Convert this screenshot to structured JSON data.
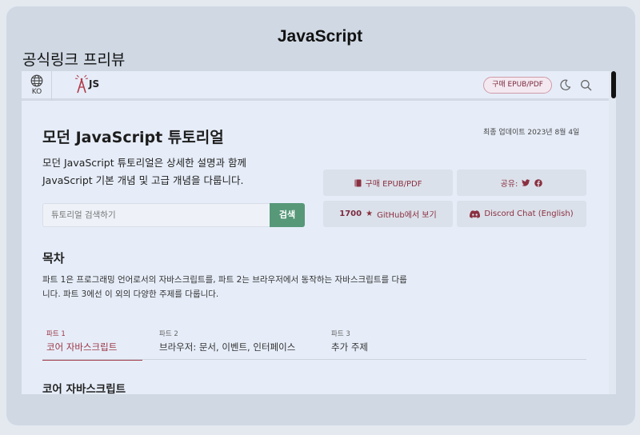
{
  "card": {
    "title": "JavaScript",
    "subtitle": "공식링크 프리뷰"
  },
  "topbar": {
    "lang_code": "KO",
    "logo_text": "JS",
    "buy_label": "구매 EPUB/PDF"
  },
  "page": {
    "title": "모던 JavaScript 튜토리얼",
    "updated": "최종 업데이트 2023년 8월 4일",
    "intro_line1": "모던 JavaScript 튜토리얼은 상세한 설명과 함께",
    "intro_line2": "JavaScript 기본 개념 및 고급 개념을 다룹니다."
  },
  "search": {
    "placeholder": "튜토리얼 검색하기",
    "button": "검색"
  },
  "buttons": {
    "buy": "구매 EPUB/PDF",
    "share": "공유:",
    "github_count": "1700",
    "github_label": "GitHub에서 보기",
    "discord": "Discord Chat (English)"
  },
  "toc": {
    "title": "목차",
    "desc_line1": "파트 1은 프로그래밍 언어로서의 자바스크립트를, 파트 2는 브라우저에서 동작하는 자바스크립트를 다룹",
    "desc_line2": "니다. 파트 3에선 이 외의 다양한 주제를 다룹니다."
  },
  "tabs": [
    {
      "num": "파트 1",
      "label": "코어 자바스크립트",
      "active": true
    },
    {
      "num": "파트 2",
      "label": "브라우저: 문서, 이벤트, 인터페이스"
    },
    {
      "num": "파트 3",
      "label": "추가 주제"
    }
  ],
  "section": {
    "title": "코어 자바스크립트"
  },
  "colors": {
    "accent": "#9b3444",
    "search_button": "#579879",
    "button_bg": "#dbe1ea",
    "page_bg": "#e6edf8"
  }
}
